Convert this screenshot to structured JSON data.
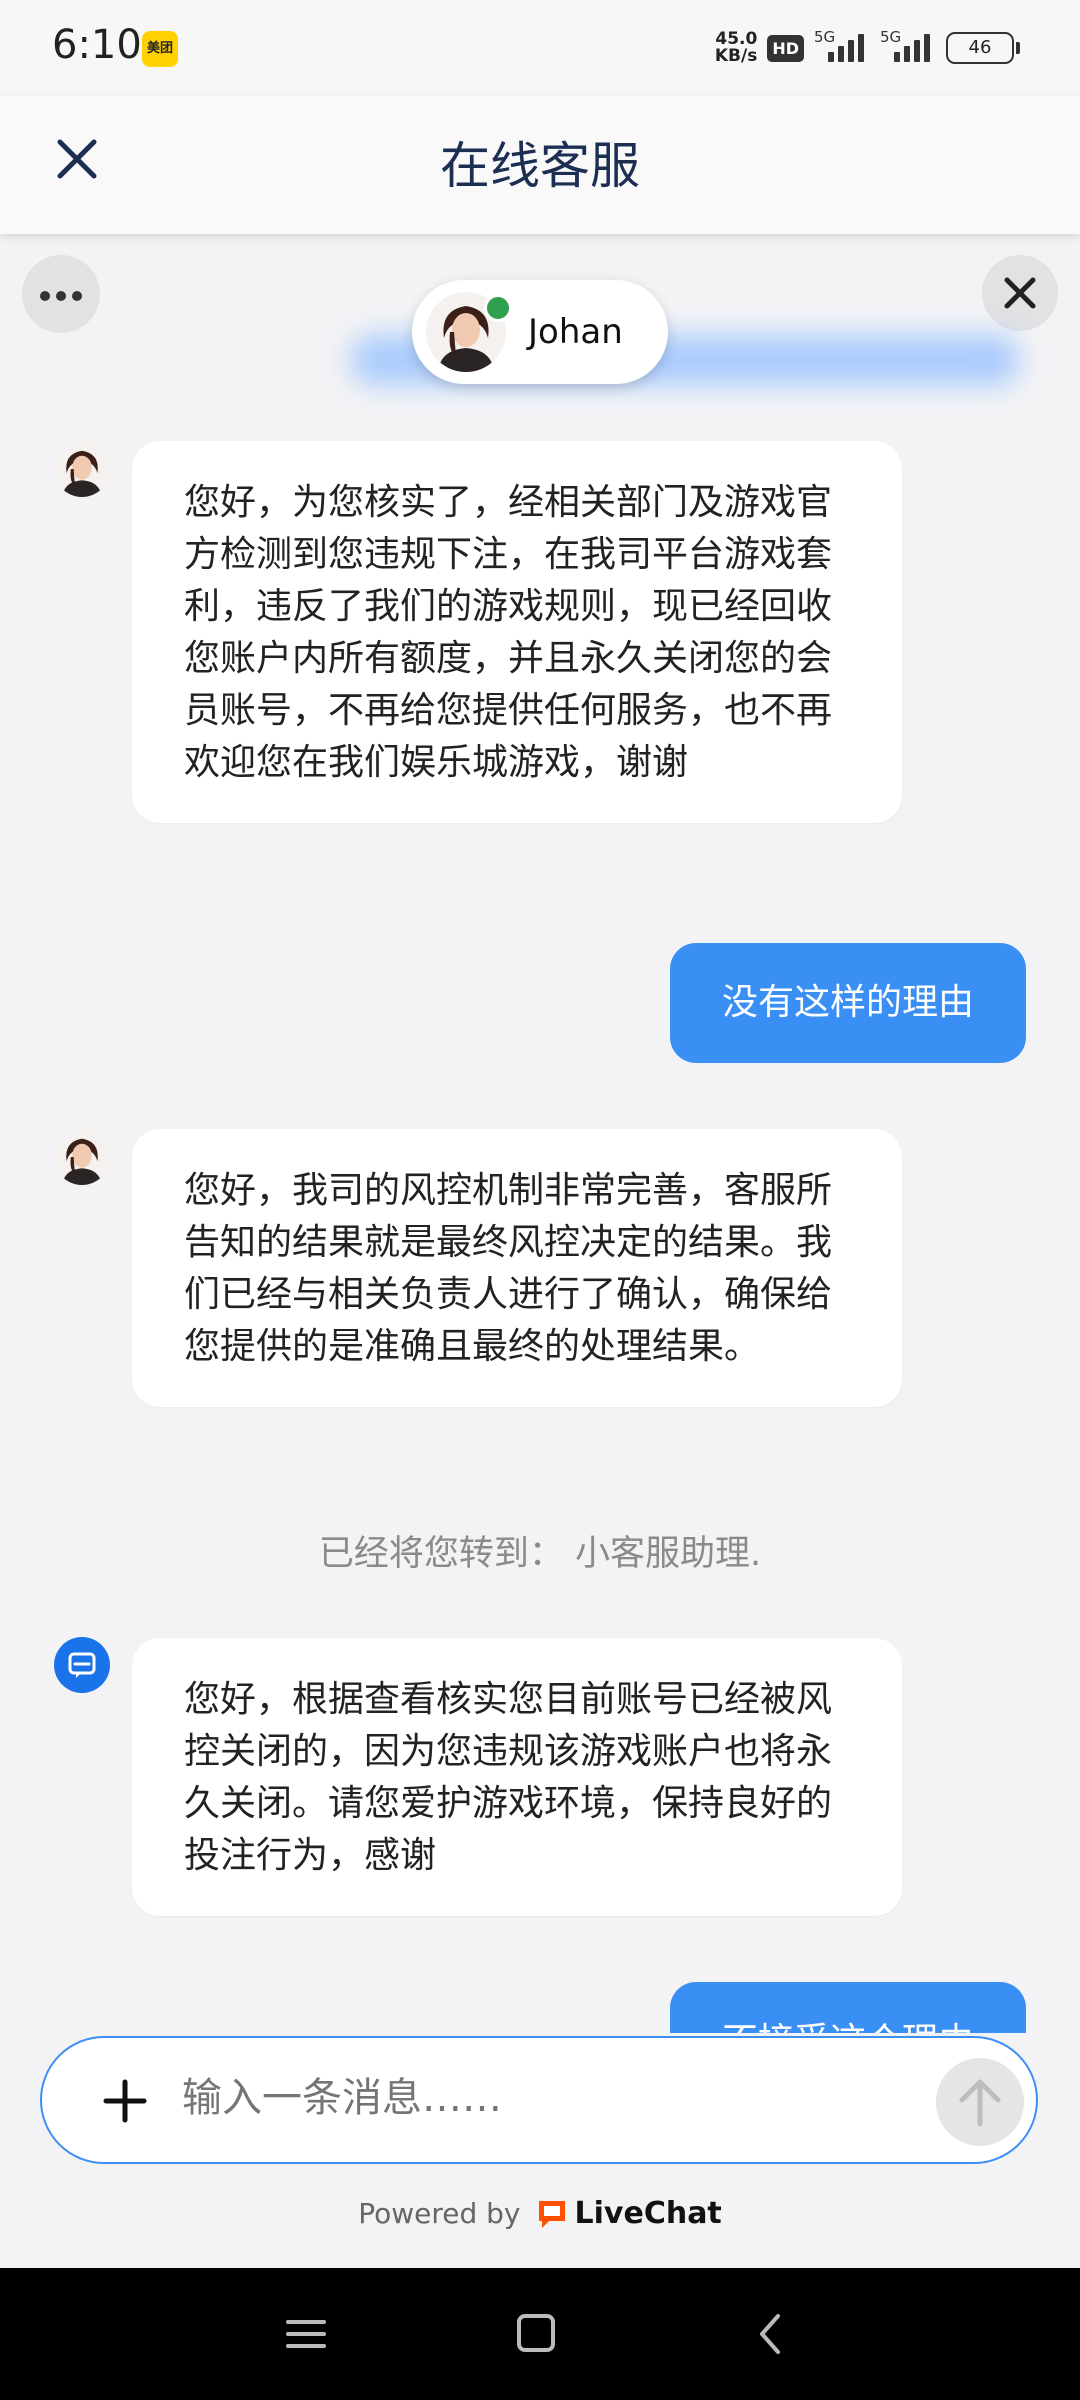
{
  "status_bar": {
    "time": "6:10",
    "app_badge": "美团",
    "net_speed_value": "45.0",
    "net_speed_unit": "KB/s",
    "hd_badge": "HD",
    "sim1_label": "5G",
    "sim2_label": "5G",
    "battery": "46"
  },
  "header": {
    "title": "在线客服"
  },
  "agent": {
    "name": "Johan",
    "status_color": "#2ea04f"
  },
  "messages": [
    {
      "from": "agent",
      "text": "您好，为您核实了，经相关部门及游戏官方检测到您违规下注，在我司平台游戏套利，违反了我们的游戏规则，现已经回收您账户内所有额度，并且永久关闭您的会员账号，不再给您提供任何服务，也不再欢迎您在我们娱乐城游戏，谢谢"
    },
    {
      "from": "user",
      "text": "没有这样的理由"
    },
    {
      "from": "agent",
      "text": "您好，我司的风控机制非常完善，客服所告知的结果就是最终风控决定的结果。我们已经与相关负责人进行了确认，确保给您提供的是准确且最终的处理结果。"
    },
    {
      "from": "system",
      "text": "已经将您转到：  小客服助理."
    },
    {
      "from": "bot",
      "text": "您好，根据查看核实您目前账号已经被风控关闭的，因为您违规该游戏账户也将永久关闭。请您爱护游戏环境，保持良好的投注行为，感谢"
    },
    {
      "from": "user",
      "text": "不接受这个理由"
    }
  ],
  "composer": {
    "placeholder": "输入一条消息……"
  },
  "footer": {
    "powered_by": "Powered by",
    "brand": "LiveChat",
    "brand_color": "#ff5100"
  },
  "colors": {
    "accent": "#3a8ff5",
    "header_text": "#1c2f52",
    "background": "#f3f3f5"
  }
}
